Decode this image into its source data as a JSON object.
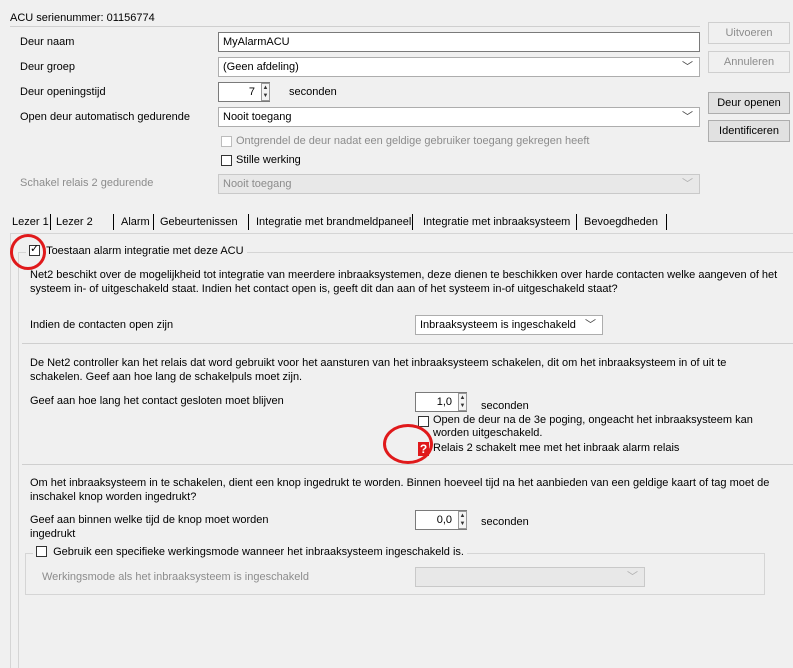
{
  "header": {
    "acu_label": "ACU serienummer: 01156774",
    "door_name_label": "Deur naam",
    "door_name_value": "MyAlarmACU",
    "door_group_label": "Deur groep",
    "door_group_value": "(Geen afdeling)",
    "open_time_label": "Deur openingstijd",
    "open_time_value": "7",
    "open_time_unit": "seconden",
    "auto_open_label": "Open deur automatisch gedurende",
    "auto_open_value": "Nooit toegang",
    "unlock_after_user_label": "Ontgrendel de deur nadat een geldige gebruiker toegang gekregen heeft",
    "silent_label": "Stille werking",
    "relay2_label": "Schakel relais 2 gedurende",
    "relay2_value": "Nooit toegang"
  },
  "buttons": {
    "execute": "Uitvoeren",
    "cancel": "Annuleren",
    "open_door": "Deur openen",
    "identify": "Identificeren"
  },
  "tabs": [
    "Lezer 1",
    "Lezer 2",
    "Alarm",
    "Gebeurtenissen",
    "Integratie met brandmeldpaneel",
    "Integratie met inbraaksysteem",
    "Bevoegdheden"
  ],
  "intrusion": {
    "enable_label": "Toestaan alarm integratie met deze ACU",
    "intro_text": "Net2 beschikt over de mogelijkheid tot integratie van meerdere inbraaksystemen, deze dienen te beschikken over harde contacten welke aangeven of het systeem in- of uitgeschakeld staat. Indien het contact open is, geeft dit dan aan of het systeem in-of uitgeschakeld staat?",
    "contacts_open_label": "Indien de contacten open zijn",
    "contacts_open_value": "Inbraaksysteem is ingeschakeld",
    "relay_text": "De Net2 controller kan het relais dat word gebruikt voor het aansturen van het inbraaksysteem schakelen, dit om het inbraaksysteem in of uit te schakelen. Geef aan hoe lang de schakelpuls moet zijn.",
    "contact_closed_label": "Geef aan hoe lang het contact gesloten moet blijven",
    "contact_closed_value": "1,0",
    "contact_closed_unit": "seconden",
    "open_third_try_label": "Open de deur na de 3e poging, ongeacht het inbraaksysteem kan worden uitgeschakeld.",
    "relay2_switch_label": "Relais 2 schakelt mee met het inbraak alarm relais",
    "arm_text": "Om het inbraaksysteem in te schakelen, dient een knop ingedrukt te worden. Binnen hoeveel tijd na het aanbieden van een geldige kaart of tag moet de inschakel knop worden ingedrukt?",
    "button_time_label": "Geef aan binnen welke tijd de knop moet worden ingedrukt",
    "button_time_value": "0,0",
    "button_time_unit": "seconden",
    "specific_mode_label": "Gebruik een specifieke werkingsmode wanneer het inbraaksysteem ingeschakeld is.",
    "mode_label": "Werkingsmode als het inbraaksysteem is ingeschakeld",
    "mode_value": ""
  },
  "colors": {
    "annotation": "#e0191b"
  }
}
